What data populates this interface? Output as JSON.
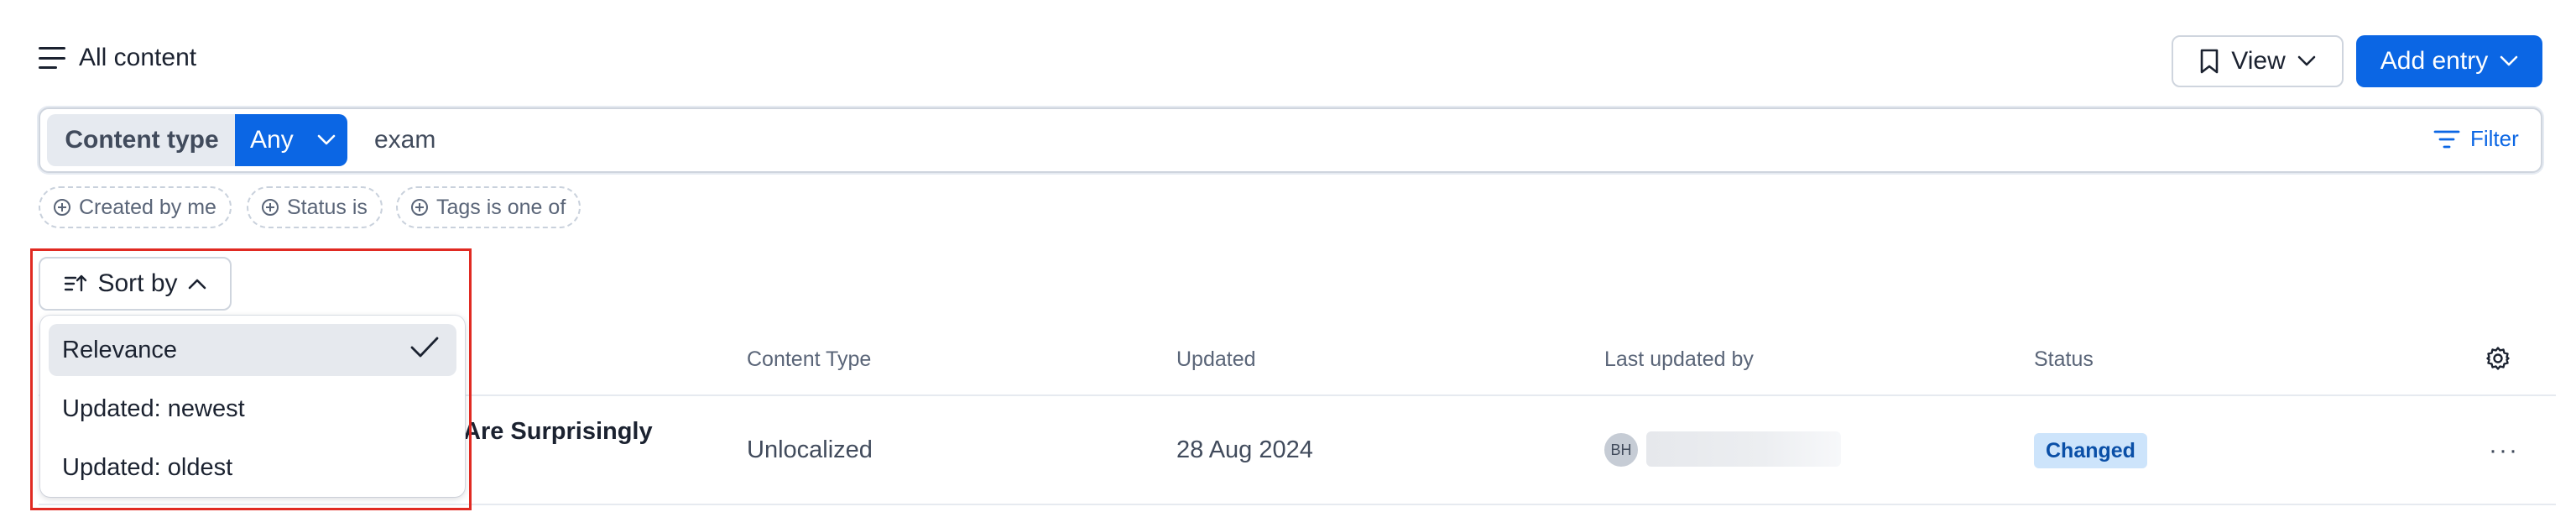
{
  "header": {
    "title": "All content",
    "view_label": "View",
    "add_entry_label": "Add entry"
  },
  "search": {
    "content_type_label": "Content type",
    "content_type_value": "Any",
    "query": "exam",
    "filter_label": "Filter"
  },
  "chips": [
    "Created by me",
    "Status is",
    "Tags is one of"
  ],
  "sort": {
    "button_label": "Sort by",
    "options": [
      "Relevance",
      "Updated: newest",
      "Updated: oldest"
    ],
    "selected": "Relevance"
  },
  "table": {
    "columns": [
      "Content Type",
      "Updated",
      "Last updated by",
      "Status"
    ],
    "rows": [
      {
        "title_fragment": "Are Surprisingly",
        "content_type": "Unlocalized",
        "updated": "28 Aug 2024",
        "avatar_initials": "BH",
        "status": "Changed"
      }
    ]
  },
  "colors": {
    "accent": "#0b66e4",
    "status_badge_bg": "#cde4fb",
    "status_badge_text": "#0a4fa7",
    "highlight_border": "#e02a22"
  },
  "icons": [
    "hamburger-icon",
    "bookmark-icon",
    "chevron-down-icon",
    "filter-icon",
    "plus-circle-icon",
    "sort-icon",
    "chevron-up-icon",
    "check-icon",
    "gear-icon",
    "more-icon"
  ]
}
